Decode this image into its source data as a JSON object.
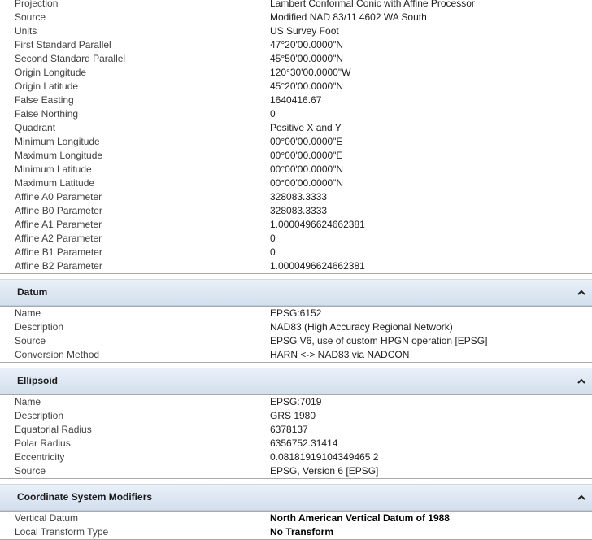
{
  "projection": {
    "rows": [
      {
        "label": "Projection",
        "value": "Lambert Conformal Conic with Affine Processor"
      },
      {
        "label": "Source",
        "value": "Modified NAD 83/11 4602 WA South"
      },
      {
        "label": "Units",
        "value": "US Survey Foot"
      },
      {
        "label": "First Standard Parallel",
        "value": "47°20'00.0000\"N"
      },
      {
        "label": "Second Standard Parallel",
        "value": "45°50'00.0000\"N"
      },
      {
        "label": "Origin Longitude",
        "value": "120°30'00.0000\"W"
      },
      {
        "label": "Origin Latitude",
        "value": "45°20'00.0000\"N"
      },
      {
        "label": "False Easting",
        "value": "1640416.67"
      },
      {
        "label": "False Northing",
        "value": "0"
      },
      {
        "label": "Quadrant",
        "value": "Positive X and Y"
      },
      {
        "label": "Minimum Longitude",
        "value": "00°00'00.0000\"E"
      },
      {
        "label": "Maximum Longitude",
        "value": "00°00'00.0000\"E"
      },
      {
        "label": "Minimum Latitude",
        "value": "00°00'00.0000\"N"
      },
      {
        "label": "Maximum Latitude",
        "value": "00°00'00.0000\"N"
      },
      {
        "label": "Affine A0 Parameter",
        "value": "328083.3333"
      },
      {
        "label": "Affine B0 Parameter",
        "value": "328083.3333"
      },
      {
        "label": "Affine A1 Parameter",
        "value": "1.0000496624662381"
      },
      {
        "label": "Affine A2 Parameter",
        "value": "0"
      },
      {
        "label": "Affine B1 Parameter",
        "value": "0"
      },
      {
        "label": "Affine B2 Parameter",
        "value": "1.0000496624662381"
      }
    ]
  },
  "datum": {
    "title": "Datum",
    "collapse_icon": "chevron-up-icon",
    "rows": [
      {
        "label": "Name",
        "value": "EPSG:6152"
      },
      {
        "label": "Description",
        "value": "NAD83 (High Accuracy Regional Network)"
      },
      {
        "label": "Source",
        "value": "EPSG V6, use of custom HPGN operation [EPSG]"
      },
      {
        "label": "Conversion Method",
        "value": "HARN <-> NAD83 via NADCON"
      }
    ]
  },
  "ellipsoid": {
    "title": "Ellipsoid",
    "collapse_icon": "chevron-up-icon",
    "rows": [
      {
        "label": "Name",
        "value": "EPSG:7019"
      },
      {
        "label": "Description",
        "value": "GRS 1980"
      },
      {
        "label": "Equatorial Radius",
        "value": "6378137"
      },
      {
        "label": "Polar Radius",
        "value": "6356752.31414"
      },
      {
        "label": "Eccentricity",
        "value": "0.08181919104349465 2"
      },
      {
        "label": "Source",
        "value": "EPSG, Version 6 [EPSG]"
      }
    ]
  },
  "modifiers": {
    "title": "Coordinate System Modifiers",
    "collapse_icon": "chevron-up-icon",
    "rows": [
      {
        "label": "Vertical Datum",
        "value": "North American Vertical Datum of 1988"
      },
      {
        "label": "Local Transform Type",
        "value": "No Transform"
      }
    ]
  },
  "colors": {
    "header_bg": "#dde7f3",
    "border": "#a9a9a9"
  }
}
